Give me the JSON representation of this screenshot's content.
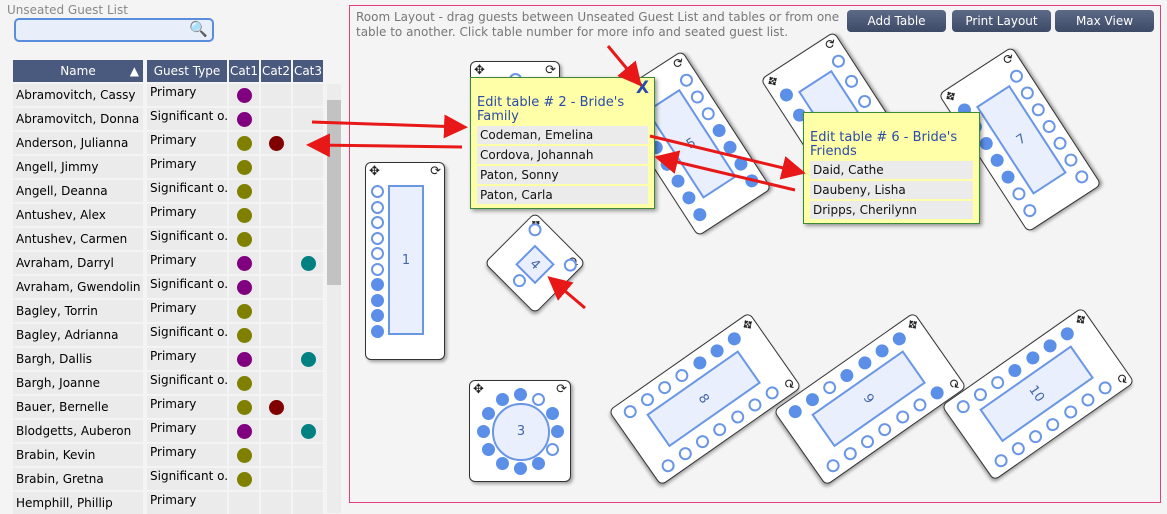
{
  "sidebar": {
    "title": "Unseated Guest List",
    "search": {
      "value": "",
      "placeholder": ""
    },
    "columns": [
      "Name",
      "Guest Type",
      "Cat1",
      "Cat2",
      "Cat3"
    ],
    "rows": [
      {
        "name": "Abramovitch, Cassy",
        "type": "Primary",
        "cats": [
          "purple",
          null,
          null
        ]
      },
      {
        "name": "Abramovitch, Donna",
        "type": "Significant o...",
        "cats": [
          "purple",
          null,
          null
        ]
      },
      {
        "name": "Anderson, Julianna",
        "type": "Primary",
        "cats": [
          "olive",
          "maroon",
          null
        ]
      },
      {
        "name": "Angell, Jimmy",
        "type": "Primary",
        "cats": [
          "olive",
          null,
          null
        ]
      },
      {
        "name": "Angell, Deanna",
        "type": "Significant o...",
        "cats": [
          "olive",
          null,
          null
        ]
      },
      {
        "name": "Antushev, Alex",
        "type": "Primary",
        "cats": [
          "olive",
          null,
          null
        ]
      },
      {
        "name": "Antushev, Carmen",
        "type": "Significant o...",
        "cats": [
          "olive",
          null,
          null
        ]
      },
      {
        "name": "Avraham, Darryl",
        "type": "Primary",
        "cats": [
          "purple",
          null,
          "teal"
        ]
      },
      {
        "name": "Avraham, Gwendolin",
        "type": "Significant o...",
        "cats": [
          "purple",
          null,
          null
        ]
      },
      {
        "name": "Bagley, Torrin",
        "type": "Primary",
        "cats": [
          "olive",
          null,
          null
        ]
      },
      {
        "name": "Bagley, Adrianna",
        "type": "Significant o...",
        "cats": [
          "olive",
          null,
          null
        ]
      },
      {
        "name": "Bargh, Dallis",
        "type": "Primary",
        "cats": [
          "purple",
          null,
          "teal"
        ]
      },
      {
        "name": "Bargh, Joanne",
        "type": "Significant o...",
        "cats": [
          "olive",
          null,
          null
        ]
      },
      {
        "name": "Bauer, Bernelle",
        "type": "Primary",
        "cats": [
          "olive",
          "maroon",
          null
        ]
      },
      {
        "name": "Blodgetts, Auberon",
        "type": "Primary",
        "cats": [
          "purple",
          null,
          "teal"
        ]
      },
      {
        "name": "Brabin, Kevin",
        "type": "Primary",
        "cats": [
          "olive",
          null,
          null
        ]
      },
      {
        "name": "Brabin, Gretna",
        "type": "Significant o...",
        "cats": [
          "olive",
          null,
          null
        ]
      },
      {
        "name": "Hemphill, Phillip",
        "type": "Primary",
        "cats": [
          null,
          null,
          null
        ]
      }
    ]
  },
  "colors": {
    "purple": "#800080",
    "olive": "#808000",
    "maroon": "#800000",
    "teal": "#008080",
    "accent": "#4a5a7e"
  },
  "room": {
    "description": "Room Layout - drag guests between Unseated Guest List and tables or from one table to another. Click table number for more info and seated guest list.",
    "buttons": [
      "Add Table",
      "Print Layout",
      "Max View"
    ],
    "tables": [
      {
        "number": "1",
        "seats": [
          0,
          0,
          0,
          0,
          0,
          0,
          1,
          1,
          1,
          1
        ]
      },
      {
        "number": "2",
        "seats": [
          0,
          1,
          0,
          1,
          0,
          1,
          0,
          1,
          0,
          1,
          0,
          1
        ]
      },
      {
        "number": "3",
        "seats": [
          1,
          0,
          1,
          1,
          0,
          1,
          1,
          1,
          1,
          1,
          1,
          1
        ]
      },
      {
        "number": "4",
        "seats": [
          0,
          0,
          0
        ]
      },
      {
        "number": "5",
        "seats": [
          1,
          1,
          1,
          1,
          1,
          1,
          1,
          0,
          0,
          0,
          1,
          1,
          1,
          1
        ]
      },
      {
        "number": "6",
        "seats": [
          1,
          1,
          1,
          1,
          1,
          1,
          0,
          0,
          0,
          0,
          0,
          0
        ]
      },
      {
        "number": "7",
        "seats": [
          1,
          1,
          1,
          1,
          1,
          0,
          0,
          0,
          0,
          0,
          0,
          0,
          0,
          0
        ]
      },
      {
        "number": "8",
        "seats": [
          1,
          1,
          1,
          0,
          0,
          0,
          0,
          0,
          0,
          0,
          0,
          0,
          0,
          0
        ]
      },
      {
        "number": "9",
        "seats": [
          1,
          1,
          1,
          1,
          0,
          1,
          1,
          1,
          0,
          0,
          0,
          0,
          0,
          0
        ]
      },
      {
        "number": "10",
        "seats": [
          1,
          1,
          1,
          1,
          0,
          0,
          0,
          0,
          0,
          0,
          0,
          0,
          0,
          0
        ]
      }
    ],
    "popups": [
      {
        "title": "Edit table # 2 - Bride's Family",
        "close": "X",
        "guests": [
          "Codeman, Emelina",
          "Cordova, Johannah",
          "Paton, Sonny",
          "Paton, Carla"
        ]
      },
      {
        "title": "Edit table # 6 - Bride's Friends",
        "guests": [
          "Daid, Cathe",
          "Daubeny, Lisha",
          "Dripps, Cherilynn"
        ]
      }
    ]
  }
}
